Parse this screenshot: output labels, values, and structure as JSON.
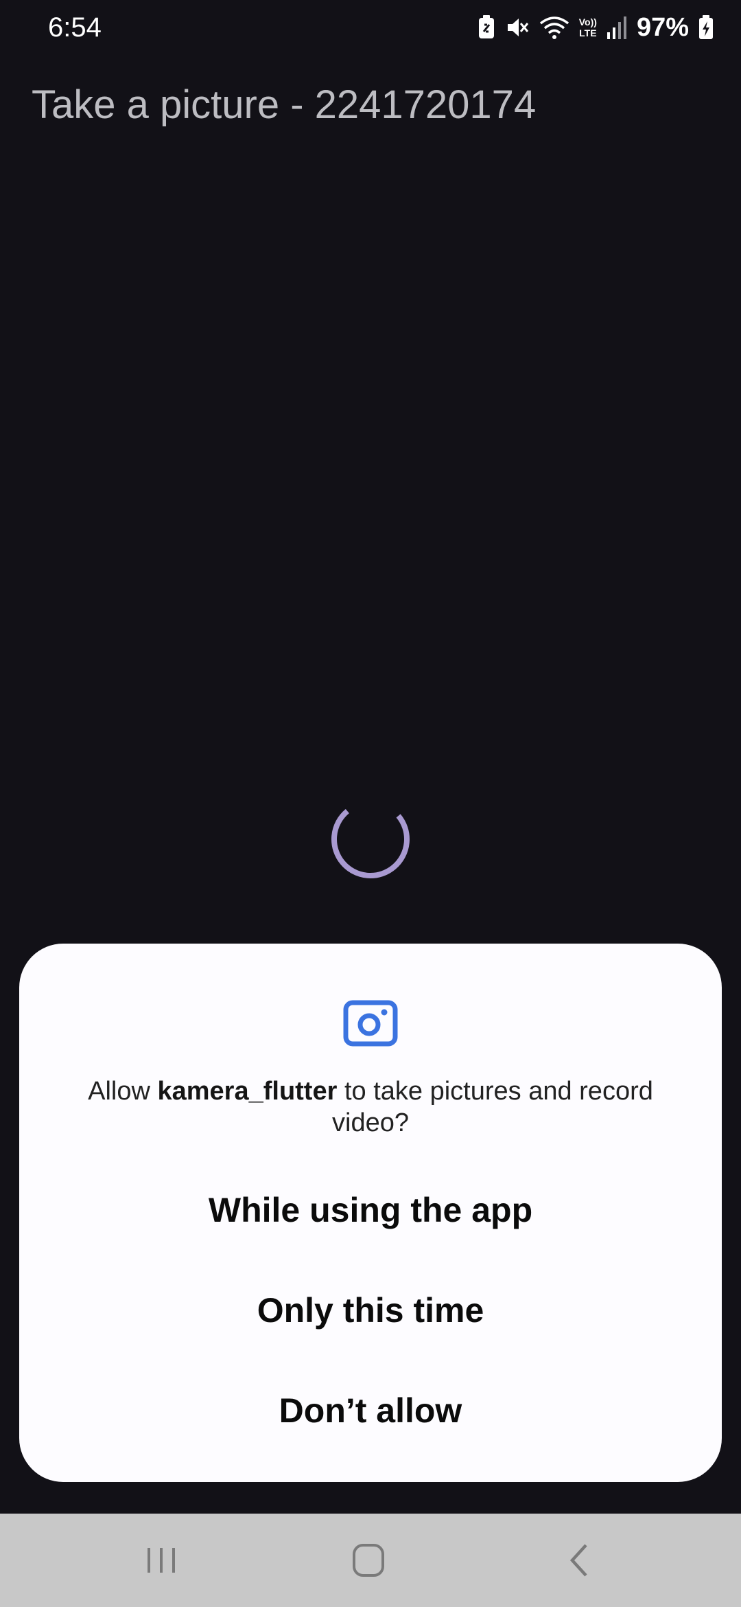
{
  "status_bar": {
    "time": "6:54",
    "battery_percent": "97%",
    "icons": [
      "battery-saver-icon",
      "mute-icon",
      "wifi-icon",
      "volte-icon",
      "signal-icon",
      "battery-charging-icon"
    ],
    "volte_label_top": "Vo))",
    "volte_label_bottom": "LTE"
  },
  "app": {
    "title": "Take a picture - 2241720174",
    "loading_indicator": "progress-spinner",
    "accent_color": "#a99ad1"
  },
  "permission_dialog": {
    "icon": "camera-icon",
    "icon_color": "#3b73e0",
    "message_prefix": "Allow ",
    "app_name": "kamera_flutter",
    "message_suffix": " to take pictures and record video?",
    "options": [
      {
        "label": "While using the app"
      },
      {
        "label": "Only this time"
      },
      {
        "label": "Don’t allow"
      }
    ]
  },
  "nav_bar": {
    "buttons": [
      "recents-icon",
      "home-icon",
      "back-icon"
    ]
  }
}
